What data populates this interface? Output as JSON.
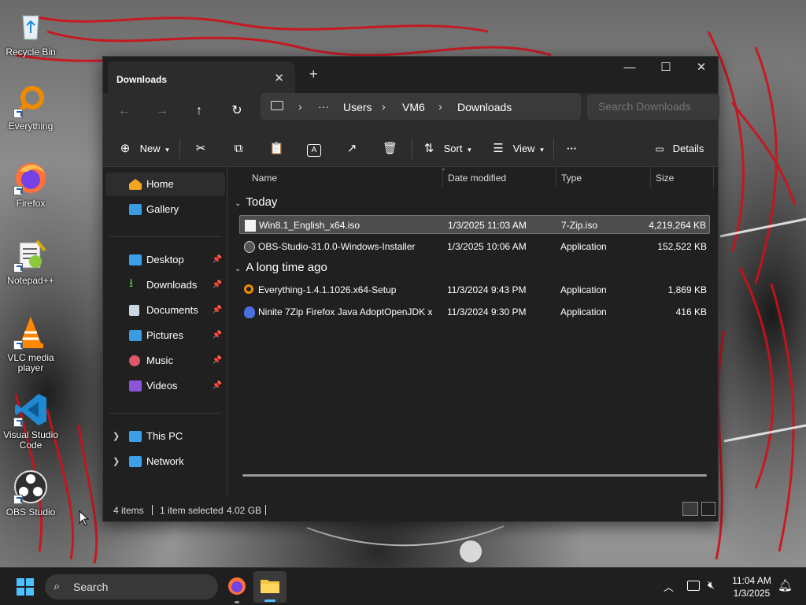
{
  "desktop": {
    "icons": [
      {
        "label": "Recycle Bin",
        "icon": "recycle-bin-icon"
      },
      {
        "label": "Everything",
        "icon": "everything-search-icon"
      },
      {
        "label": "Firefox",
        "icon": "firefox-icon"
      },
      {
        "label": "Notepad++",
        "icon": "notepad-plus-plus-icon"
      },
      {
        "label": "VLC media player",
        "icon": "vlc-icon"
      },
      {
        "label": "Visual Studio Code",
        "icon": "vscode-icon"
      },
      {
        "label": "OBS Studio",
        "icon": "obs-icon"
      }
    ]
  },
  "window": {
    "tab_title": "Downloads",
    "tab_close": "✕",
    "new_tab": "+",
    "controls": {
      "minimize": "—",
      "maximize": "☐",
      "close": "✕"
    },
    "address": {
      "more": "···",
      "segments": [
        "Users",
        "VM6",
        "Downloads"
      ],
      "separator": "›"
    },
    "search_placeholder": "Search Downloads",
    "toolbar": {
      "new_label": "New",
      "sort_label": "Sort",
      "view_label": "View",
      "more": "···",
      "details_label": "Details"
    },
    "sidebar": {
      "top": [
        {
          "label": "Home",
          "selected": true
        },
        {
          "label": "Gallery"
        }
      ],
      "quick": [
        {
          "label": "Desktop"
        },
        {
          "label": "Downloads"
        },
        {
          "label": "Documents"
        },
        {
          "label": "Pictures"
        },
        {
          "label": "Music"
        },
        {
          "label": "Videos"
        }
      ],
      "bottom": [
        {
          "label": "This PC"
        },
        {
          "label": "Network"
        }
      ]
    },
    "columns": {
      "name": "Name",
      "date": "Date modified",
      "type": "Type",
      "size": "Size"
    },
    "groups": [
      {
        "title": "Today",
        "files": [
          {
            "name": "Win8.1_English_x64.iso",
            "date": "1/3/2025 11:03 AM",
            "type": "7-Zip.iso",
            "size": "4,219,264 KB",
            "selected": true
          },
          {
            "name": "OBS-Studio-31.0.0-Windows-Installer",
            "date": "1/3/2025 10:06 AM",
            "type": "Application",
            "size": "152,522 KB"
          }
        ]
      },
      {
        "title": "A long time ago",
        "files": [
          {
            "name": "Everything-1.4.1.1026.x64-Setup",
            "date": "11/3/2024 9:43 PM",
            "type": "Application",
            "size": "1,869 KB"
          },
          {
            "name": "Ninite 7Zip Firefox Java AdoptOpenJDK x...",
            "date": "11/3/2024 9:30 PM",
            "type": "Application",
            "size": "416 KB"
          }
        ]
      }
    ],
    "status": {
      "items": "4 items",
      "selected": "1 item selected",
      "size": "4.02 GB"
    }
  },
  "taskbar": {
    "search_label": "Search",
    "time": "11:04 AM",
    "date": "1/3/2025"
  }
}
